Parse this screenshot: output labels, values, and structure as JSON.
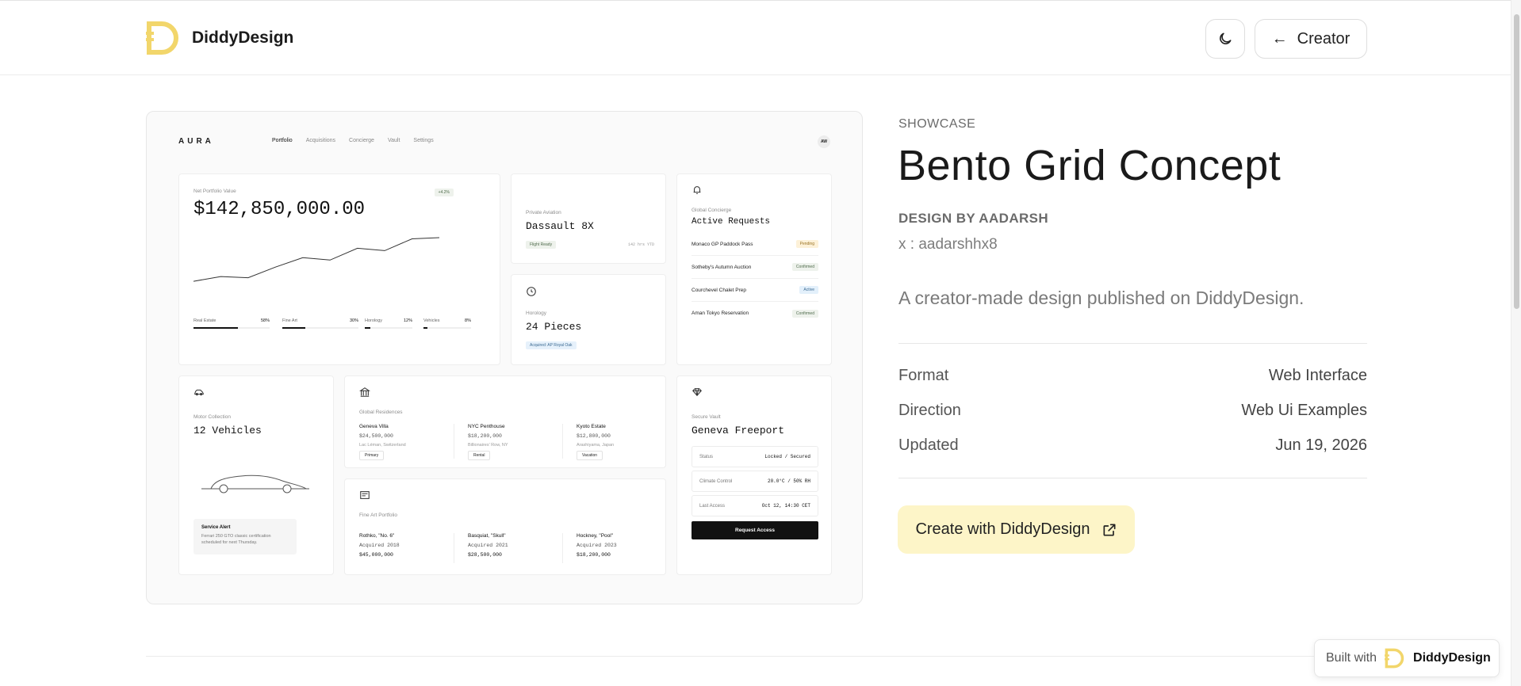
{
  "header": {
    "brand": "DiddyDesign",
    "creator_label": "Creator",
    "back_arrow": "←"
  },
  "preview": {
    "logo": "AURA",
    "nav": [
      "Portfolio",
      "Acquisitions",
      "Concierge",
      "Vault",
      "Settings"
    ],
    "avatar": "AW",
    "net": {
      "label": "Net Portfolio Value",
      "value": "$142,850,000.00",
      "badge": "+4.2%",
      "allocations": [
        {
          "label": "Real Estate",
          "pct": "58%",
          "fill": 0.58
        },
        {
          "label": "Fine Art",
          "pct": "30%",
          "fill": 0.3
        },
        {
          "label": "Horology",
          "pct": "12%",
          "fill": 0.12
        },
        {
          "label": "Vehicles",
          "pct": "8%",
          "fill": 0.08
        }
      ],
      "trend": [
        10,
        14,
        13,
        22,
        30,
        28,
        38,
        36,
        46,
        47
      ]
    },
    "aviation": {
      "label": "Private Aviation",
      "value": "Dassault 8X",
      "tag": "Flight Ready",
      "hours": "142 hrs YTD"
    },
    "horology": {
      "label": "Horology",
      "value": "24 Pieces",
      "tag": "Acquired: AP Royal Oak"
    },
    "concierge": {
      "label": "Global Concierge",
      "value": "Active Requests",
      "items": [
        {
          "name": "Monaco GP Paddock Pass",
          "status": "Pending"
        },
        {
          "name": "Sotheby's Autumn Auction",
          "status": "Confirmed"
        },
        {
          "name": "Courchevel Chalet Prep",
          "status": "Active"
        },
        {
          "name": "Aman Tokyo Reservation",
          "status": "Confirmed"
        }
      ]
    },
    "motor": {
      "label": "Motor Collection",
      "value": "12 Vehicles",
      "alert_title": "Service Alert",
      "alert_text": "Ferrari 250 GTO classic certification scheduled for next Thursday."
    },
    "residences": {
      "label": "Global Residences",
      "items": [
        {
          "name": "Geneva Villa",
          "price": "$24,500,000",
          "loc": "Lac Léman, Switzerland",
          "tag": "Primary"
        },
        {
          "name": "NYC Penthouse",
          "price": "$18,200,000",
          "loc": "Billionaires' Row, NY",
          "tag": "Rental"
        },
        {
          "name": "Kyoto Estate",
          "price": "$12,800,000",
          "loc": "Arashiyama, Japan",
          "tag": "Vacation"
        }
      ]
    },
    "art": {
      "label": "Fine Art Portfolio",
      "items": [
        {
          "name": "Rothko, \"No. 6\"",
          "acq": "Acquired 2018",
          "price": "$45,000,000"
        },
        {
          "name": "Basquiat, \"Skull\"",
          "acq": "Acquired 2021",
          "price": "$28,500,000"
        },
        {
          "name": "Hockney, \"Pool\"",
          "acq": "Acquired 2023",
          "price": "$18,200,000"
        }
      ]
    },
    "vault": {
      "label": "Secure Vault",
      "value": "Geneva Freeport",
      "rows": [
        {
          "k": "Status",
          "v": "Locked / Secured"
        },
        {
          "k": "Climate Control",
          "v": "20.0°C / 50% RH"
        },
        {
          "k": "Last Access",
          "v": "Oct 12, 14:30 CET"
        }
      ],
      "button": "Request Access"
    }
  },
  "detail": {
    "eyebrow": "SHOWCASE",
    "title": "Bento Grid Concept",
    "design_by": "DESIGN BY AADARSH",
    "handle": "x : aadarshhx8",
    "description": "A creator-made design published on DiddyDesign.",
    "meta": [
      {
        "k": "Format",
        "v": "Web Interface"
      },
      {
        "k": "Direction",
        "v": "Web Ui Examples"
      },
      {
        "k": "Updated",
        "v": "Jun 19, 2026"
      }
    ],
    "cta": "Create with DiddyDesign"
  },
  "badge": {
    "prefix": "Built with",
    "name": "DiddyDesign"
  },
  "colors": {
    "brand_yellow": "#f2d66b",
    "cta_bg": "#fdf5c8"
  }
}
